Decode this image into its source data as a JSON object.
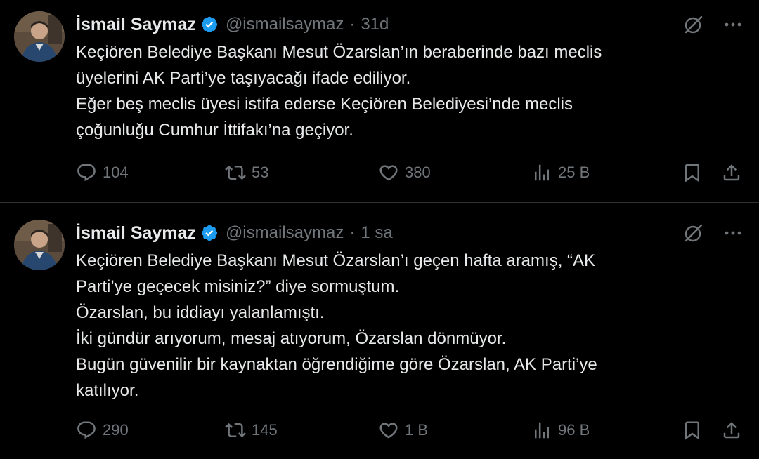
{
  "colors": {
    "background": "#000000",
    "text_primary": "#e7e9ea",
    "text_secondary": "#71767b",
    "verified_blue": "#1d9bf0",
    "divider": "#2f3336"
  },
  "tweets": [
    {
      "author": {
        "name": "İsmail Saymaz",
        "handle": "@ismailsaymaz",
        "separator": "·",
        "time": "31d",
        "verified_icon": "verified-badge-icon",
        "avatar_icon": "avatar"
      },
      "lines": [
        "Keçiören Belediye Başkanı Mesut Özarslan’ın beraberinde bazı meclis",
        "üyelerini AK Parti’ye taşıyacağı ifade ediliyor.",
        "Eğer beş meclis üyesi istifa ederse Keçiören Belediyesi’nde meclis",
        "çoğunluğu Cumhur İttifakı’na geçiyor."
      ],
      "stats": {
        "replies": "104",
        "retweets": "53",
        "likes": "380",
        "views": "25 B"
      }
    },
    {
      "author": {
        "name": "İsmail Saymaz",
        "handle": "@ismailsaymaz",
        "separator": "·",
        "time": "1 sa",
        "verified_icon": "verified-badge-icon",
        "avatar_icon": "avatar"
      },
      "lines": [
        "Keçiören Belediye Başkanı Mesut Özarslan’ı geçen hafta aramış, “AK",
        "Parti’ye geçecek misiniz?” diye sormuştum.",
        "Özarslan, bu iddiayı yalanlamıştı.",
        "İki gündür arıyorum, mesaj atıyorum, Özarslan dönmüyor.",
        "Bugün güvenilir bir kaynaktan öğrendiğime göre Özarslan, AK Parti’ye",
        "katılıyor."
      ],
      "stats": {
        "replies": "290",
        "retweets": "145",
        "likes": "1 B",
        "views": "96 B"
      }
    }
  ]
}
